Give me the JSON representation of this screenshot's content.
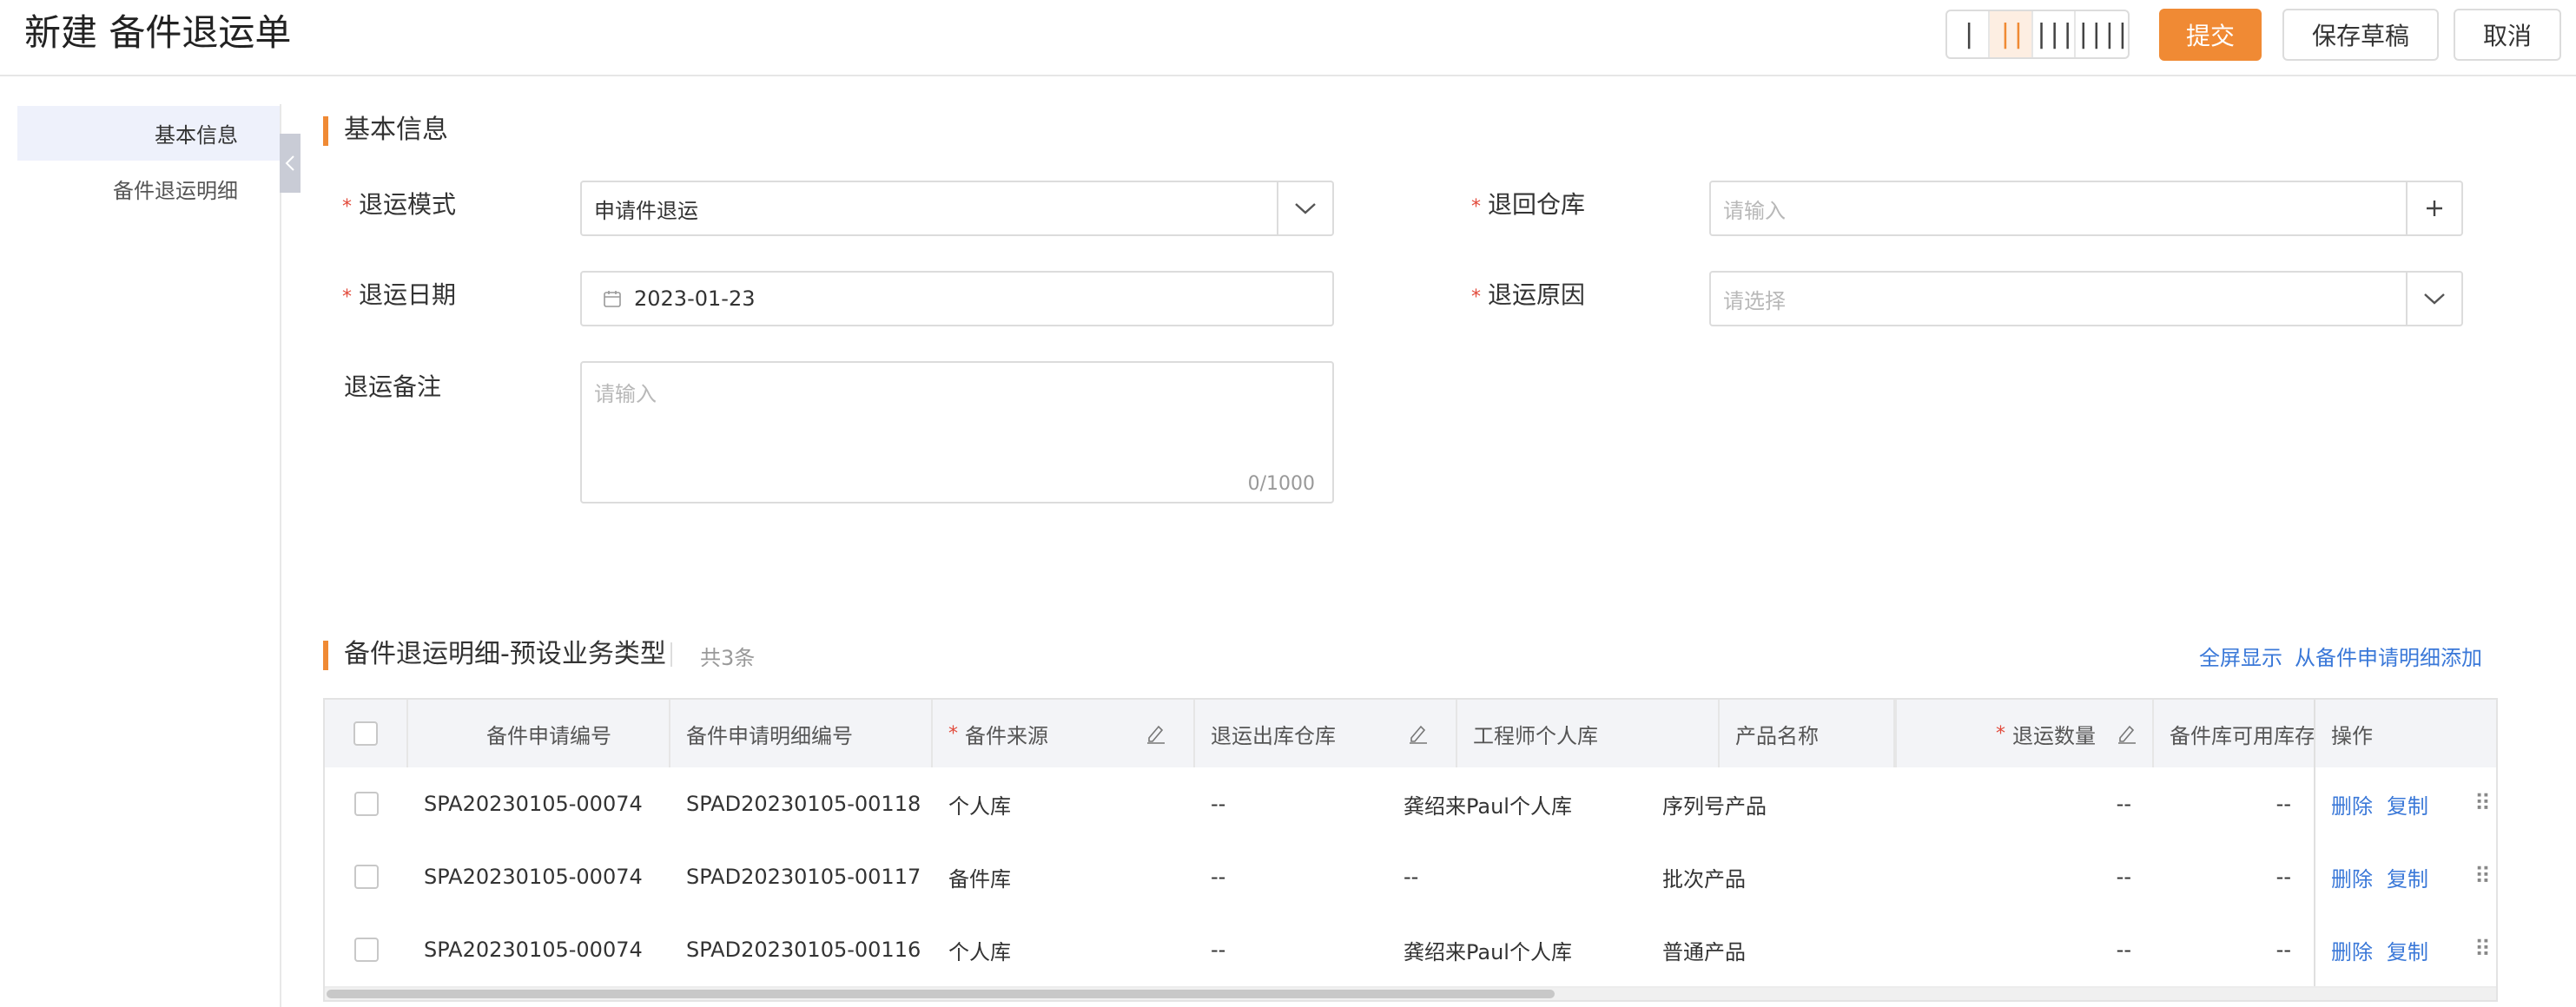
{
  "header": {
    "title": "新建 备件退运单",
    "layout_options": [
      "|",
      "||",
      "|||",
      "||||"
    ],
    "active_layout": 1,
    "submit_label": "提交",
    "save_draft_label": "保存草稿",
    "cancel_label": "取消",
    "accent_color": "#f08a34"
  },
  "sidebar": {
    "items": [
      {
        "label": "基本信息",
        "active": true
      },
      {
        "label": "备件退运明细",
        "active": false
      }
    ],
    "collapse_icon": "chevron-left-icon"
  },
  "basic_info": {
    "section_title": "基本信息",
    "return_mode": {
      "label": "退运模式",
      "value": "申请件退运",
      "required": true
    },
    "return_warehouse": {
      "label": "退回仓库",
      "placeholder": "请输入",
      "required": true
    },
    "return_date": {
      "label": "退运日期",
      "value": "2023-01-23",
      "required": true
    },
    "return_reason": {
      "label": "退运原因",
      "placeholder": "请选择",
      "required": true
    },
    "return_remark": {
      "label": "退运备注",
      "placeholder": "请输入",
      "counter": "0/1000"
    }
  },
  "details": {
    "section_title": "备件退运明细-预设业务类型",
    "count_text": "共3条",
    "fullscreen_label": "全屏显示",
    "add_from_request_label": "从备件申请明细添加",
    "columns": [
      {
        "label": "备件申请编号"
      },
      {
        "label": "备件申请明细编号"
      },
      {
        "label": "备件来源",
        "required": true,
        "editable": true
      },
      {
        "label": "退运出库仓库",
        "editable": true
      },
      {
        "label": "工程师个人库"
      },
      {
        "label": "产品名称"
      },
      {
        "label": "退运数量",
        "required": true,
        "editable": true
      },
      {
        "label": "备件库可用库存"
      },
      {
        "label": "操作"
      }
    ],
    "rows": [
      {
        "request_no": "SPA20230105-00074",
        "detail_no": "SPAD20230105-00118",
        "source": "个人库",
        "out_warehouse": "--",
        "engineer_store": "龚绍来Paul个人库",
        "product": "序列号产品",
        "qty": "--",
        "stock": "--",
        "delete": "删除",
        "copy": "复制"
      },
      {
        "request_no": "SPA20230105-00074",
        "detail_no": "SPAD20230105-00117",
        "source": "备件库",
        "out_warehouse": "--",
        "engineer_store": "--",
        "product": "批次产品",
        "qty": "--",
        "stock": "--",
        "delete": "删除",
        "copy": "复制"
      },
      {
        "request_no": "SPA20230105-00074",
        "detail_no": "SPAD20230105-00116",
        "source": "个人库",
        "out_warehouse": "--",
        "engineer_store": "龚绍来Paul个人库",
        "product": "普通产品",
        "qty": "--",
        "stock": "--",
        "delete": "删除",
        "copy": "复制"
      }
    ]
  }
}
